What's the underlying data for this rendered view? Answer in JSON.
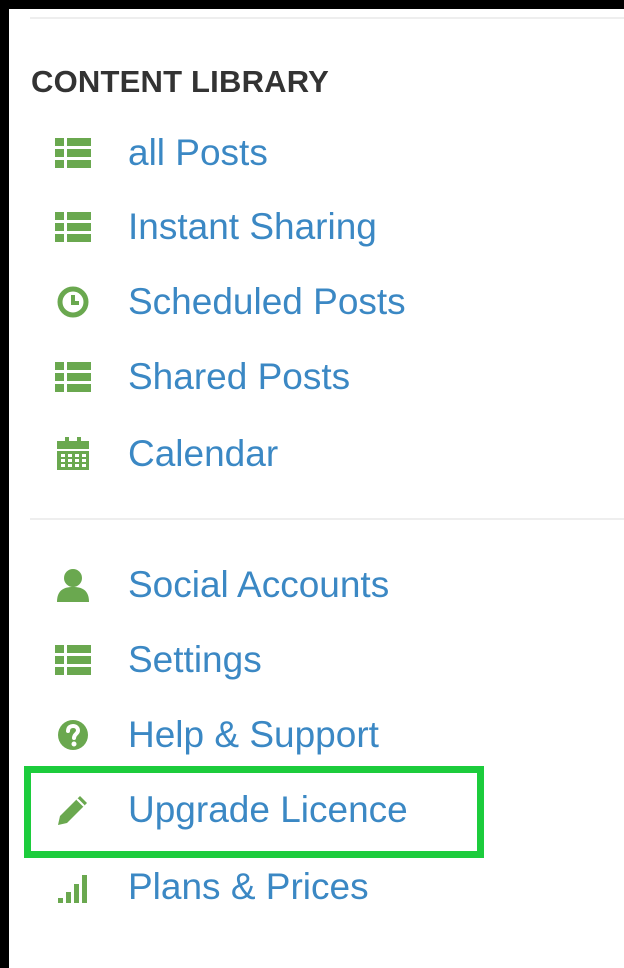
{
  "sidebar": {
    "heading": "CONTENT LIBRARY",
    "content_items": [
      {
        "label": "all Posts",
        "icon": "list-icon"
      },
      {
        "label": "Instant Sharing",
        "icon": "list-icon"
      },
      {
        "label": "Scheduled Posts",
        "icon": "clock-icon"
      },
      {
        "label": "Shared Posts",
        "icon": "list-icon"
      },
      {
        "label": "Calendar",
        "icon": "calendar-icon"
      }
    ],
    "account_items": [
      {
        "label": "Social Accounts",
        "icon": "user-icon"
      },
      {
        "label": "Settings",
        "icon": "list-icon"
      },
      {
        "label": "Help & Support",
        "icon": "question-circle-icon"
      },
      {
        "label": "Upgrade Licence",
        "icon": "pencil-icon",
        "highlighted": true
      },
      {
        "label": "Plans & Prices",
        "icon": "signal-bars-icon"
      }
    ]
  },
  "colors": {
    "icon": "#6aa84f",
    "link": "#3b88c4",
    "heading": "#333333",
    "highlight": "#1ccc3c"
  }
}
